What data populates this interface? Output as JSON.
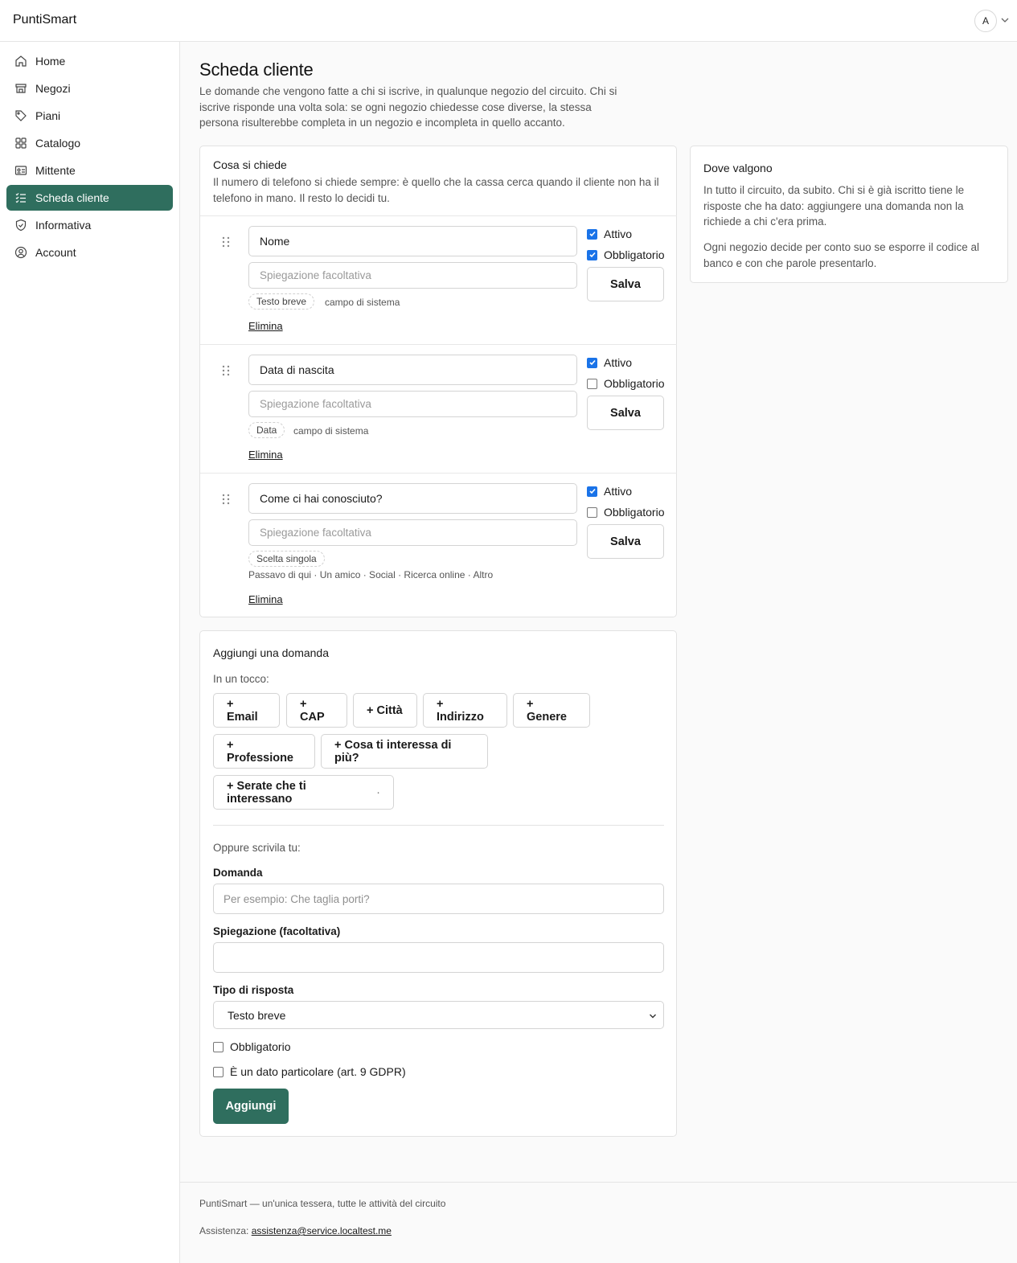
{
  "app": {
    "brand": "PuntiSmart",
    "avatar_initial": "A"
  },
  "sidebar": {
    "items": [
      {
        "label": "Home",
        "icon": "home-icon"
      },
      {
        "label": "Negozi",
        "icon": "store-icon"
      },
      {
        "label": "Piani",
        "icon": "tag-icon"
      },
      {
        "label": "Catalogo",
        "icon": "grid-icon"
      },
      {
        "label": "Mittente",
        "icon": "id-card-icon"
      },
      {
        "label": "Scheda cliente",
        "icon": "checklist-icon",
        "active": true
      },
      {
        "label": "Informativa",
        "icon": "shield-icon"
      },
      {
        "label": "Account",
        "icon": "user-circle-icon"
      }
    ]
  },
  "page": {
    "title": "Scheda cliente",
    "intro": "Le domande che vengono fatte a chi si iscrive, in qualunque negozio del circuito. Chi si iscrive risponde una volta sola: se ogni negozio chiedesse cose diverse, la stessa persona risulterebbe completa in un negozio e incompleta in quello accanto."
  },
  "questions": {
    "title": "Cosa si chiede",
    "desc": "Il numero di telefono si chiede sempre: è quello che la cassa cerca quando il cliente non ha il telefono in mano. Il resto lo decidi tu.",
    "active_label": "Attivo",
    "required_label": "Obbligatorio",
    "save_label": "Salva",
    "delete_label": "Elimina",
    "explanation_placeholder": "Spiegazione facoltativa",
    "items": [
      {
        "name": "Nome",
        "type": "Testo breve",
        "system": "campo di sistema",
        "active": true,
        "required": true
      },
      {
        "name": "Data di nascita",
        "type": "Data",
        "system": "campo di sistema",
        "active": true,
        "required": false
      },
      {
        "name": "Come ci hai conosciuto?",
        "type": "Scelta singola",
        "options": "Passavo di qui · Un amico · Social · Ricerca online · Altro",
        "active": true,
        "required": false
      }
    ]
  },
  "where": {
    "title": "Dove valgono",
    "p1": "In tutto il circuito, da subito. Chi si è già iscritto tiene le risposte che ha dato: aggiungere una domanda non la richiede a chi c'era prima.",
    "p2": "Ogni negozio decide per conto suo se esporre il codice al banco e con che parole presentarlo."
  },
  "add": {
    "title": "Aggiungi una domanda",
    "quick_label": "In un tocco:",
    "quick": [
      "+ Email",
      "+ CAP",
      "+ Città",
      "+ Indirizzo",
      "+ Genere",
      "+ Professione",
      "+ Cosa ti interessa di più?",
      "+ Serate che ti interessano"
    ],
    "quick_extra": "·",
    "or_label": "Oppure scrivila tu:",
    "question_label": "Domanda",
    "question_placeholder": "Per esempio: Che taglia porti?",
    "expl_label": "Spiegazione (facoltativa)",
    "type_label": "Tipo di risposta",
    "type_value": "Testo breve",
    "required_label": "Obbligatorio",
    "gdpr_label": "È un dato particolare (art. 9 GDPR)",
    "submit": "Aggiungi"
  },
  "footer": {
    "tagline": "PuntiSmart — un'unica tessera, tutte le attività del circuito",
    "support_label": "Assistenza:",
    "support_email": "assistenza@service.localtest.me"
  }
}
